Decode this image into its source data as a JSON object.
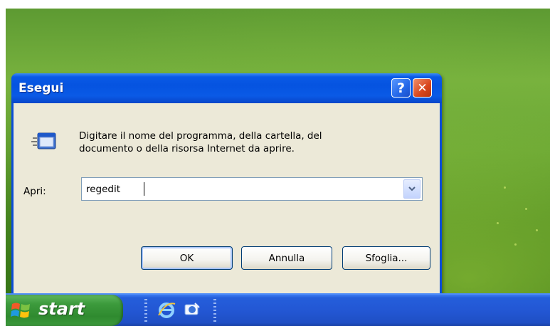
{
  "dialog": {
    "title": "Esegui",
    "help_glyph": "?",
    "close_glyph": "✕",
    "prompt_line1": "Digitare il nome del programma, della cartella, del",
    "prompt_line2": "documento o della risorsa Internet da aprire.",
    "open_label": "Apri:",
    "open_value": "regedit",
    "buttons": {
      "ok": "OK",
      "cancel": "Annulla",
      "browse": "Sfoglia..."
    }
  },
  "taskbar": {
    "start_label": "start",
    "quick_launch": [
      "internet-explorer-icon",
      "outlook-express-icon"
    ]
  },
  "colors": {
    "title_bar": "#0553e0",
    "dialog_body": "#ece9d8",
    "close_button": "#d8461c",
    "start_button": "#3c9a3c",
    "taskbar": "#245edb"
  }
}
